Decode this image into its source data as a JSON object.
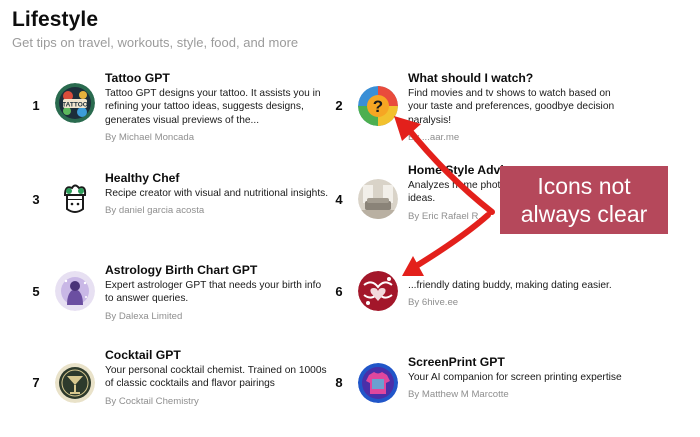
{
  "page": {
    "title": "Lifestyle",
    "subtitle": "Get tips on travel, workouts, style, food, and more"
  },
  "items": [
    {
      "rank": "1",
      "name": "Tattoo GPT",
      "description": "Tattoo GPT designs your tattoo. It assists you in refining your tattoo ideas, suggests designs, generates visual previews of the...",
      "author": "By Michael Moncada",
      "icon": "tattoo-icon"
    },
    {
      "rank": "2",
      "name": "What should I watch?",
      "description": "Find movies and tv shows to watch based on your taste and preferences, goodbye decision paralysis!",
      "author": "By ...aar.me",
      "icon": "question-mark-icon"
    },
    {
      "rank": "3",
      "name": "Healthy Chef",
      "description": "Recipe creator with visual and nutritional insights.",
      "author": "By daniel garcia acosta",
      "icon": "chef-icon"
    },
    {
      "rank": "4",
      "name": "Home Style Advisor",
      "description": "Analyzes home photos... matching style, and u... ideas.",
      "author": "By Eric Rafael R...",
      "icon": "living-room-icon"
    },
    {
      "rank": "5",
      "name": "Astrology Birth Chart GPT",
      "description": "Expert astrologer GPT that needs your birth info to answer queries.",
      "author": "By Dalexa Limited",
      "icon": "astrologer-icon"
    },
    {
      "rank": "6",
      "name": "...",
      "description": "...friendly dating buddy, making dating easier.",
      "author": "By 6hive.ee",
      "icon": "dating-icon"
    },
    {
      "rank": "7",
      "name": "Cocktail GPT",
      "description": "Your personal cocktail chemist. Trained on 1000s of classic cocktails and flavor pairings",
      "author": "By Cocktail Chemistry",
      "icon": "cocktail-glass-icon"
    },
    {
      "rank": "8",
      "name": "ScreenPrint GPT",
      "description": "Your AI companion for screen printing expertise",
      "author": "By Matthew M Marcotte",
      "icon": "tshirt-icon"
    }
  ],
  "annotation": {
    "line1": "Icons not",
    "line2": "always clear",
    "color": "#b5485b",
    "arrow_color": "#e3201b"
  }
}
